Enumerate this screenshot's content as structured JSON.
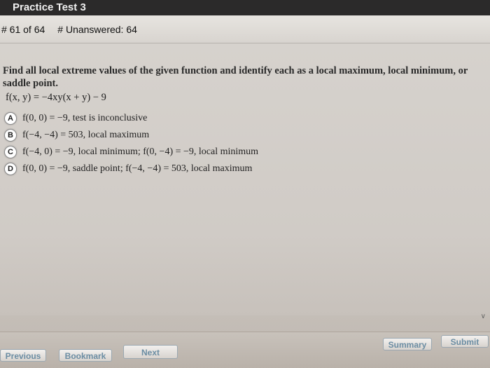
{
  "window": {
    "title": "Practice Test 3"
  },
  "status": {
    "question_number": "# 61 of 64",
    "unanswered": "# Unanswered: 64"
  },
  "question": {
    "prompt": "Find all local extreme values of the given function and identify each as a local maximum, local minimum, or saddle point.",
    "function": "f(x, y) = −4xy(x + y) − 9"
  },
  "choices": [
    {
      "letter": "A",
      "text": "f(0, 0) = −9, test is inconclusive"
    },
    {
      "letter": "B",
      "text": "f(−4, −4) = 503, local maximum"
    },
    {
      "letter": "C",
      "text": "f(−4, 0) = −9, local minimum; f(0, −4) = −9, local minimum"
    },
    {
      "letter": "D",
      "text": "f(0, 0) = −9, saddle point; f(−4, −4) = 503, local maximum"
    }
  ],
  "nav": {
    "previous": "Previous",
    "bookmark": "Bookmark",
    "next": "Next",
    "summary": "Summary",
    "submit": "Submit"
  },
  "icons": {
    "scroll_hint": "chevron-down-icon"
  }
}
